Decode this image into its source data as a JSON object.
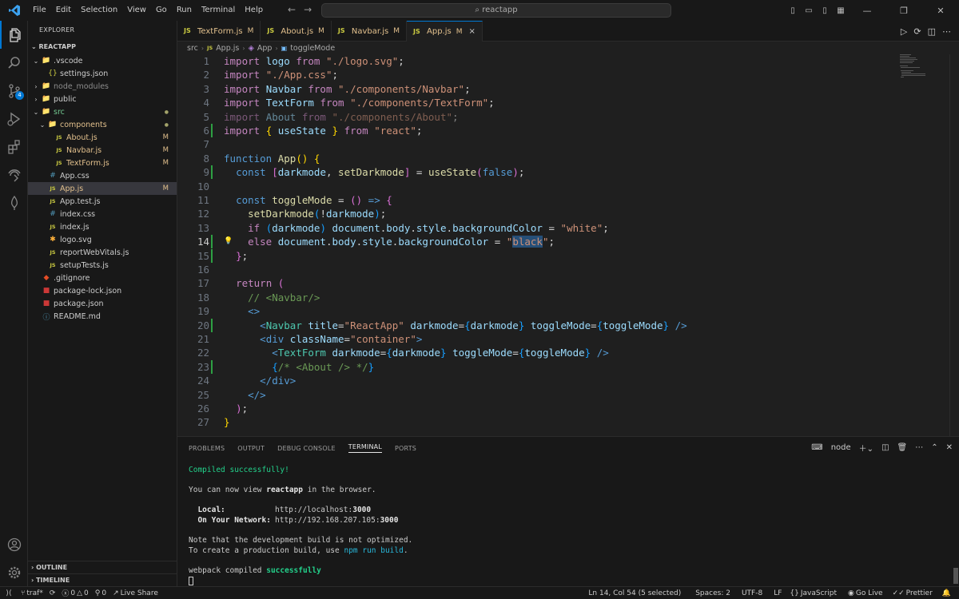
{
  "menu": [
    "File",
    "Edit",
    "Selection",
    "View",
    "Go",
    "Run",
    "Terminal",
    "Help"
  ],
  "command_center": "reactapp",
  "sidebar": {
    "title": "EXPLORER",
    "root": "REACTAPP",
    "items": [
      {
        "label": ".vscode",
        "type": "folder",
        "open": true,
        "level": 1
      },
      {
        "label": "settings.json",
        "type": "json",
        "level": 2
      },
      {
        "label": "node_modules",
        "type": "folder",
        "open": false,
        "level": 1,
        "dim": true
      },
      {
        "label": "public",
        "type": "folder",
        "open": false,
        "level": 1
      },
      {
        "label": "src",
        "type": "folder",
        "open": true,
        "level": 1,
        "color": "#73c991",
        "dot": true
      },
      {
        "label": "components",
        "type": "folder",
        "open": true,
        "level": 2,
        "color": "#e2c08d",
        "dot": true
      },
      {
        "label": "About.js",
        "type": "js",
        "level": 3,
        "color": "#e2c08d",
        "mod": "M"
      },
      {
        "label": "Navbar.js",
        "type": "js",
        "level": 3,
        "color": "#e2c08d",
        "mod": "M"
      },
      {
        "label": "TextForm.js",
        "type": "js",
        "level": 3,
        "color": "#e2c08d",
        "mod": "M"
      },
      {
        "label": "App.css",
        "type": "css",
        "level": 2
      },
      {
        "label": "App.js",
        "type": "js",
        "level": 2,
        "color": "#e2c08d",
        "mod": "M",
        "selected": true
      },
      {
        "label": "App.test.js",
        "type": "js",
        "level": 2
      },
      {
        "label": "index.css",
        "type": "css",
        "level": 2
      },
      {
        "label": "index.js",
        "type": "js",
        "level": 2
      },
      {
        "label": "logo.svg",
        "type": "svg",
        "level": 2
      },
      {
        "label": "reportWebVitals.js",
        "type": "js",
        "level": 2
      },
      {
        "label": "setupTests.js",
        "type": "js",
        "level": 2
      },
      {
        "label": ".gitignore",
        "type": "git",
        "level": 1
      },
      {
        "label": "package-lock.json",
        "type": "npm",
        "level": 1
      },
      {
        "label": "package.json",
        "type": "npm",
        "level": 1
      },
      {
        "label": "README.md",
        "type": "md",
        "level": 1
      }
    ],
    "outline": "OUTLINE",
    "timeline": "TIMELINE"
  },
  "tabs": [
    {
      "label": "TextForm.js",
      "mod": "M",
      "active": false
    },
    {
      "label": "About.js",
      "mod": "M",
      "active": false
    },
    {
      "label": "Navbar.js",
      "mod": "M",
      "active": false
    },
    {
      "label": "App.js",
      "mod": "M",
      "active": true
    }
  ],
  "tab_close": "×",
  "breadcrumb": [
    "src",
    "App.js",
    "App",
    "toggleMode"
  ],
  "editor": {
    "current_line": 14,
    "changed_lines": [
      6,
      9,
      14,
      15,
      20,
      23
    ],
    "lines": [
      [
        [
          "kw",
          "import"
        ],
        [
          "pu",
          " "
        ],
        [
          "va",
          "logo"
        ],
        [
          "pu",
          " "
        ],
        [
          "kw",
          "from"
        ],
        [
          "pu",
          " "
        ],
        [
          "st",
          "\"./logo.svg\""
        ],
        [
          "pu",
          ";"
        ]
      ],
      [
        [
          "kw",
          "import"
        ],
        [
          "pu",
          " "
        ],
        [
          "st",
          "\"./App.css\""
        ],
        [
          "pu",
          ";"
        ]
      ],
      [
        [
          "kw",
          "import"
        ],
        [
          "pu",
          " "
        ],
        [
          "va",
          "Navbar"
        ],
        [
          "pu",
          " "
        ],
        [
          "kw",
          "from"
        ],
        [
          "pu",
          " "
        ],
        [
          "st",
          "\"./components/Navbar\""
        ],
        [
          "pu",
          ";"
        ]
      ],
      [
        [
          "kw",
          "import"
        ],
        [
          "pu",
          " "
        ],
        [
          "va",
          "TextForm"
        ],
        [
          "pu",
          " "
        ],
        [
          "kw",
          "from"
        ],
        [
          "pu",
          " "
        ],
        [
          "st",
          "\"./components/TextForm\""
        ],
        [
          "pu",
          ";"
        ]
      ],
      [
        [
          "kw dim",
          "import"
        ],
        [
          "pu dim",
          " "
        ],
        [
          "va dim",
          "About"
        ],
        [
          "pu dim",
          " "
        ],
        [
          "kw dim",
          "from"
        ],
        [
          "pu dim",
          " "
        ],
        [
          "st dim",
          "\"./components/About\""
        ],
        [
          "pu dim",
          ";"
        ]
      ],
      [
        [
          "kw",
          "import"
        ],
        [
          "pu",
          " "
        ],
        [
          "br1",
          "{"
        ],
        [
          "pu",
          " "
        ],
        [
          "va",
          "useState"
        ],
        [
          "pu",
          " "
        ],
        [
          "br1",
          "}"
        ],
        [
          "pu",
          " "
        ],
        [
          "kw",
          "from"
        ],
        [
          "pu",
          " "
        ],
        [
          "st",
          "\"react\""
        ],
        [
          "pu",
          ";"
        ]
      ],
      [],
      [
        [
          "bl",
          "function"
        ],
        [
          "pu",
          " "
        ],
        [
          "fn",
          "App"
        ],
        [
          "br1",
          "()"
        ],
        [
          "pu",
          " "
        ],
        [
          "br1",
          "{"
        ]
      ],
      [
        [
          "pu",
          "  "
        ],
        [
          "bl",
          "const"
        ],
        [
          "pu",
          " "
        ],
        [
          "br2",
          "["
        ],
        [
          "va",
          "darkmode"
        ],
        [
          "pu",
          ", "
        ],
        [
          "fn",
          "setDarkmode"
        ],
        [
          "br2",
          "]"
        ],
        [
          "pu",
          " = "
        ],
        [
          "fn",
          "useState"
        ],
        [
          "br2",
          "("
        ],
        [
          "bl",
          "false"
        ],
        [
          "br2",
          ")"
        ],
        [
          "pu",
          ";"
        ]
      ],
      [],
      [
        [
          "pu",
          "  "
        ],
        [
          "bl",
          "const"
        ],
        [
          "pu",
          " "
        ],
        [
          "fn",
          "toggleMode"
        ],
        [
          "pu",
          " = "
        ],
        [
          "br2",
          "()"
        ],
        [
          "pu",
          " "
        ],
        [
          "bl",
          "=>"
        ],
        [
          "pu",
          " "
        ],
        [
          "br2",
          "{"
        ]
      ],
      [
        [
          "pu",
          "    "
        ],
        [
          "fn",
          "setDarkmode"
        ],
        [
          "br3",
          "("
        ],
        [
          "pu",
          "!"
        ],
        [
          "va",
          "darkmode"
        ],
        [
          "br3",
          ")"
        ],
        [
          "pu",
          ";"
        ]
      ],
      [
        [
          "pu",
          "    "
        ],
        [
          "kw",
          "if"
        ],
        [
          "pu",
          " "
        ],
        [
          "br3",
          "("
        ],
        [
          "va",
          "darkmode"
        ],
        [
          "br3",
          ")"
        ],
        [
          "pu",
          " "
        ],
        [
          "va",
          "document"
        ],
        [
          "pu",
          "."
        ],
        [
          "va",
          "body"
        ],
        [
          "pu",
          "."
        ],
        [
          "va",
          "style"
        ],
        [
          "pu",
          "."
        ],
        [
          "va",
          "backgroundColor"
        ],
        [
          "pu",
          " = "
        ],
        [
          "st",
          "\"white\""
        ],
        [
          "pu",
          ";"
        ]
      ],
      [
        [
          "pu",
          "    "
        ],
        [
          "kw",
          "else"
        ],
        [
          "pu",
          " "
        ],
        [
          "va",
          "document"
        ],
        [
          "pu",
          "."
        ],
        [
          "va",
          "body"
        ],
        [
          "pu",
          "."
        ],
        [
          "va",
          "style"
        ],
        [
          "pu",
          "."
        ],
        [
          "va",
          "backgroundColor"
        ],
        [
          "pu",
          " = "
        ],
        [
          "st",
          "\""
        ],
        [
          "st sel",
          "black"
        ],
        [
          "st",
          "\""
        ],
        [
          "pu",
          ";"
        ]
      ],
      [
        [
          "pu",
          "  "
        ],
        [
          "br2",
          "}"
        ],
        [
          "pu",
          ";"
        ]
      ],
      [],
      [
        [
          "pu",
          "  "
        ],
        [
          "kw",
          "return"
        ],
        [
          "pu",
          " "
        ],
        [
          "br2",
          "("
        ]
      ],
      [
        [
          "pu",
          "    "
        ],
        [
          "cm",
          "// <Navbar/>"
        ]
      ],
      [
        [
          "pu",
          "    "
        ],
        [
          "bl",
          "<>"
        ]
      ],
      [
        [
          "pu",
          "      "
        ],
        [
          "bl",
          "<"
        ],
        [
          "ty",
          "Navbar"
        ],
        [
          "pu",
          " "
        ],
        [
          "va",
          "title"
        ],
        [
          "pu",
          "="
        ],
        [
          "st",
          "\"ReactApp\""
        ],
        [
          "pu",
          " "
        ],
        [
          "va",
          "darkmode"
        ],
        [
          "pu",
          "="
        ],
        [
          "br3",
          "{"
        ],
        [
          "va",
          "darkmode"
        ],
        [
          "br3",
          "}"
        ],
        [
          "pu",
          " "
        ],
        [
          "va",
          "toggleMode"
        ],
        [
          "pu",
          "="
        ],
        [
          "br3",
          "{"
        ],
        [
          "va",
          "toggleMode"
        ],
        [
          "br3",
          "}"
        ],
        [
          "pu",
          " "
        ],
        [
          "bl",
          "/>"
        ]
      ],
      [
        [
          "pu",
          "      "
        ],
        [
          "bl",
          "<"
        ],
        [
          "bl",
          "div"
        ],
        [
          "pu",
          " "
        ],
        [
          "va",
          "className"
        ],
        [
          "pu",
          "="
        ],
        [
          "st",
          "\"container\""
        ],
        [
          "bl",
          ">"
        ]
      ],
      [
        [
          "pu",
          "        "
        ],
        [
          "bl",
          "<"
        ],
        [
          "ty",
          "TextForm"
        ],
        [
          "pu",
          " "
        ],
        [
          "va",
          "darkmode"
        ],
        [
          "pu",
          "="
        ],
        [
          "br3",
          "{"
        ],
        [
          "va",
          "darkmode"
        ],
        [
          "br3",
          "}"
        ],
        [
          "pu",
          " "
        ],
        [
          "va",
          "toggleMode"
        ],
        [
          "pu",
          "="
        ],
        [
          "br3",
          "{"
        ],
        [
          "va",
          "toggleMode"
        ],
        [
          "br3",
          "}"
        ],
        [
          "pu",
          " "
        ],
        [
          "bl",
          "/>"
        ]
      ],
      [
        [
          "pu",
          "        "
        ],
        [
          "br3",
          "{"
        ],
        [
          "cm",
          "/* <About /> */"
        ],
        [
          "br3",
          "}"
        ]
      ],
      [
        [
          "pu",
          "      "
        ],
        [
          "bl",
          "</"
        ],
        [
          "bl",
          "div"
        ],
        [
          "bl",
          ">"
        ]
      ],
      [
        [
          "pu",
          "    "
        ],
        [
          "bl",
          "</>"
        ]
      ],
      [
        [
          "pu",
          "  "
        ],
        [
          "br2",
          ")"
        ],
        [
          "pu",
          ";"
        ]
      ],
      [
        [
          "br1",
          "}"
        ]
      ]
    ]
  },
  "panel": {
    "tabs": [
      "PROBLEMS",
      "OUTPUT",
      "DEBUG CONSOLE",
      "TERMINAL",
      "PORTS"
    ],
    "active_tab": "TERMINAL",
    "shell": "node",
    "terminal": {
      "compiled": "Compiled successfully!",
      "view_pre": "You can now view ",
      "app": "reactapp",
      "view_post": " in the browser.",
      "local_label": "  Local:",
      "local_url_pre": "http://localhost:",
      "local_port": "3000",
      "network_label": "  On Your Network:",
      "network_url_pre": "http://192.168.207.105:",
      "network_port": "3000",
      "note1": "Note that the development build is not optimized.",
      "note2_pre": "To create a production build, use ",
      "note2_cmd": "npm run build",
      "note2_post": ".",
      "webpack_pre": "webpack compiled ",
      "webpack_ok": "successfully"
    }
  },
  "status": {
    "branch": "traf*",
    "errors": "0",
    "warnings": "0",
    "ports": "0",
    "live_share": "Live Share",
    "position": "Ln 14, Col 54 (5 selected)",
    "spaces": "Spaces: 2",
    "encoding": "UTF-8",
    "eol": "LF",
    "language": "JavaScript",
    "golive": "Go Live",
    "prettier": "Prettier"
  }
}
